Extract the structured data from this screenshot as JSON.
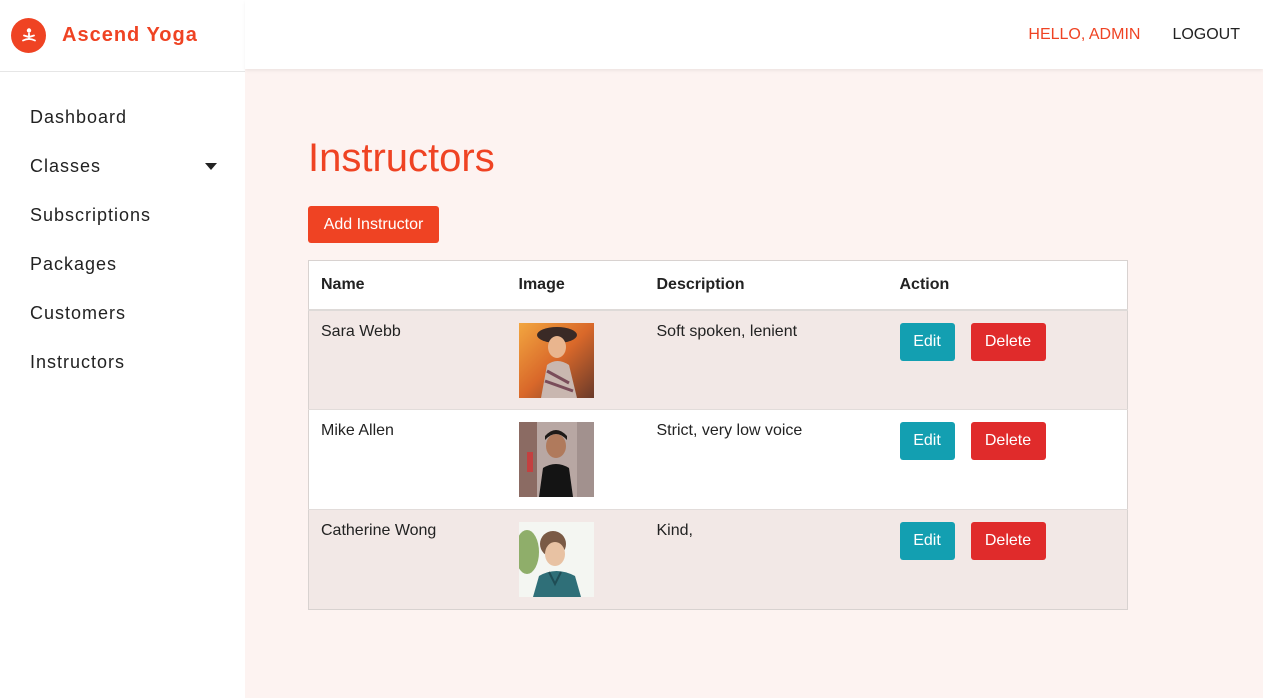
{
  "brand": {
    "name": "Ascend Yoga",
    "icon": "yoga-logo-icon",
    "color": "#ef4323"
  },
  "header": {
    "greeting": "HELLO, ADMIN",
    "logout": "LOGOUT"
  },
  "sidebar": {
    "items": [
      {
        "label": "Dashboard"
      },
      {
        "label": "Classes",
        "has_dropdown": true
      },
      {
        "label": "Subscriptions"
      },
      {
        "label": "Packages"
      },
      {
        "label": "Customers"
      },
      {
        "label": "Instructors"
      }
    ]
  },
  "main": {
    "title": "Instructors",
    "add_button": "Add Instructor",
    "table": {
      "columns": [
        "Name",
        "Image",
        "Description",
        "Action"
      ],
      "rows": [
        {
          "name": "Sara Webb",
          "description": "Soft spoken, lenient",
          "edit": "Edit",
          "delete": "Delete"
        },
        {
          "name": "Mike Allen",
          "description": "Strict, very low voice",
          "edit": "Edit",
          "delete": "Delete"
        },
        {
          "name": "Catherine Wong",
          "description": "Kind,",
          "edit": "Edit",
          "delete": "Delete"
        }
      ]
    }
  },
  "colors": {
    "accent": "#ef4323",
    "edit": "#139fb1",
    "delete": "#e02b2b",
    "background": "#fdf3f1"
  }
}
